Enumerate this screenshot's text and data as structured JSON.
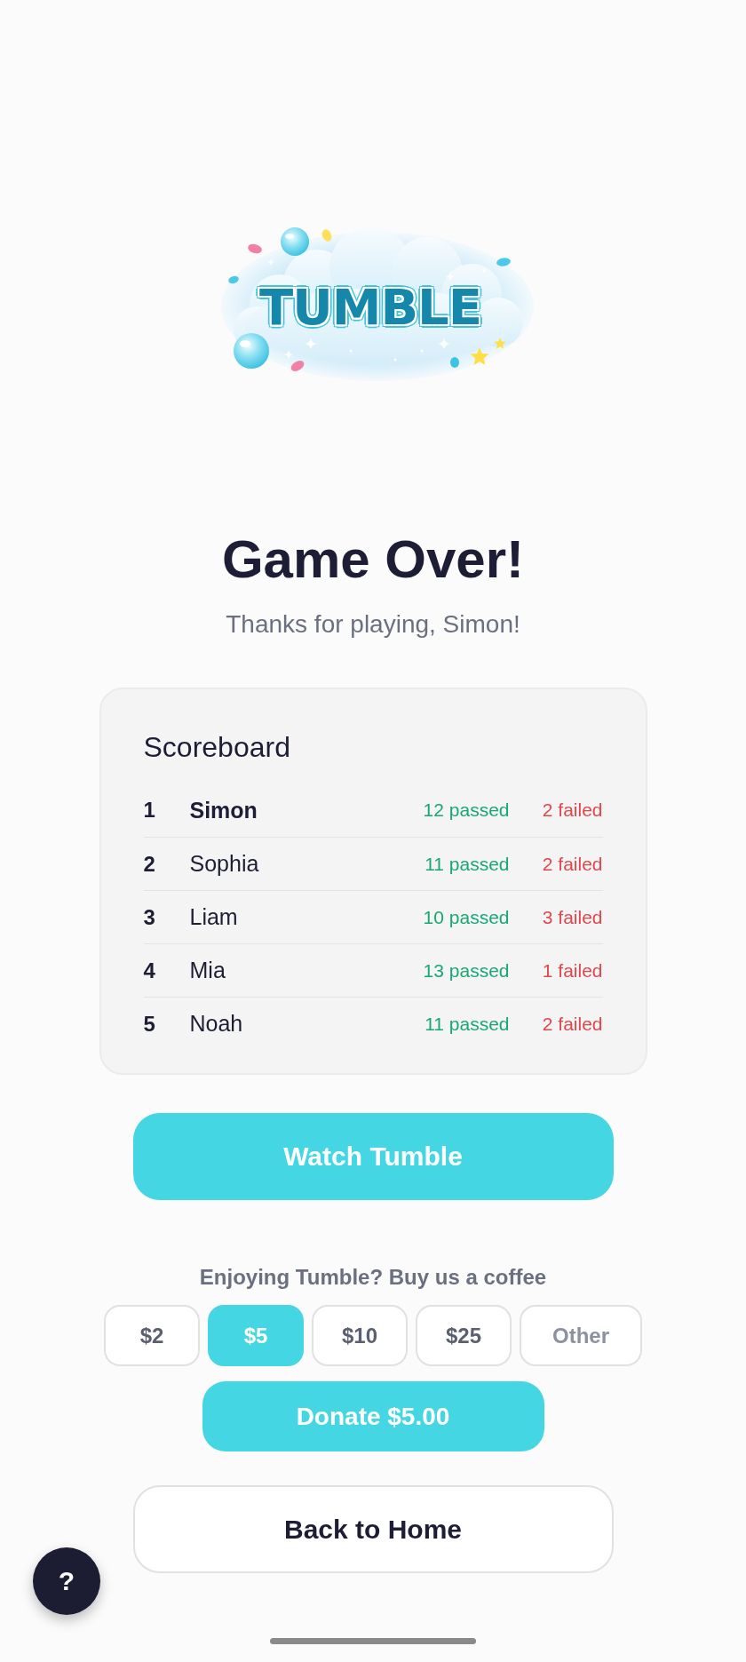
{
  "logo": {
    "text": "TUMBLE"
  },
  "heading": {
    "title": "Game Over!",
    "subtitle": "Thanks for playing, Simon!"
  },
  "scoreboard": {
    "title": "Scoreboard",
    "rows": [
      {
        "rank": "1",
        "name": "Simon",
        "passed": "12 passed",
        "failed": "2 failed",
        "current": true
      },
      {
        "rank": "2",
        "name": "Sophia",
        "passed": "11 passed",
        "failed": "2 failed",
        "current": false
      },
      {
        "rank": "3",
        "name": "Liam",
        "passed": "10 passed",
        "failed": "3 failed",
        "current": false
      },
      {
        "rank": "4",
        "name": "Mia",
        "passed": "13 passed",
        "failed": "1 failed",
        "current": false
      },
      {
        "rank": "5",
        "name": "Noah",
        "passed": "11 passed",
        "failed": "2 failed",
        "current": false
      }
    ]
  },
  "watch_button": {
    "label": "Watch Tumble"
  },
  "donation": {
    "prompt": "Enjoying Tumble? Buy us a coffee",
    "amounts": [
      {
        "label": "$2",
        "kind": "preset",
        "selected": false
      },
      {
        "label": "$5",
        "kind": "preset",
        "selected": true
      },
      {
        "label": "$10",
        "kind": "preset",
        "selected": false
      },
      {
        "label": "$25",
        "kind": "preset",
        "selected": false
      },
      {
        "label": "Other",
        "kind": "custom",
        "selected": false
      }
    ],
    "donate_button": {
      "label": "Donate $5.00"
    }
  },
  "home_button": {
    "label": "Back to Home"
  },
  "help_button": {
    "label": "?"
  }
}
